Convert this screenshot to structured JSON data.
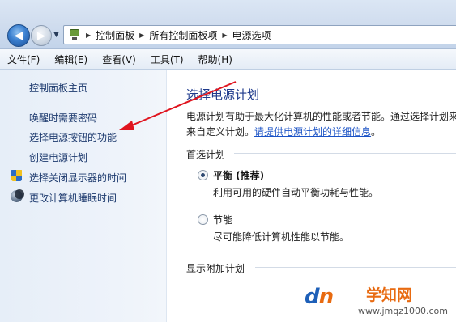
{
  "address_bar": {
    "breadcrumbs": [
      "控制面板",
      "所有控制面板项",
      "电源选项"
    ]
  },
  "menu": [
    "文件(F)",
    "编辑(E)",
    "查看(V)",
    "工具(T)",
    "帮助(H)"
  ],
  "sidebar": {
    "home": "控制面板主页",
    "items": [
      {
        "label": "唤醒时需要密码",
        "icon": null
      },
      {
        "label": "选择电源按钮的功能",
        "icon": null
      },
      {
        "label": "创建电源计划",
        "icon": null
      },
      {
        "label": "选择关闭显示器的时间",
        "icon": "shield-icon"
      },
      {
        "label": "更改计算机睡眠时间",
        "icon": "moon-icon"
      }
    ]
  },
  "main": {
    "title": "选择电源计划",
    "description_line1": "电源计划有助于最大化计算机的性能或者节能。通过选择计划来",
    "description_line2_prefix": "来自定义计划。",
    "description_link": "请提供电源计划的详细信息",
    "description_suffix": "。",
    "preferred_label": "首选计划",
    "plans": [
      {
        "name": "平衡 (推荐)",
        "desc": "利用可用的硬件自动平衡功耗与性能。",
        "selected": true
      },
      {
        "name": "节能",
        "desc": "尽可能降低计算机性能以节能。",
        "selected": false
      }
    ],
    "additional_label": "显示附加计划"
  },
  "watermark": {
    "logo_d": "d",
    "logo_n": "n",
    "name": "学知网",
    "url": "www.jmqz1000.com"
  },
  "colors": {
    "annotation_arrow": "#e0141e",
    "link": "#1a52c6",
    "title": "#1e3a8c"
  }
}
